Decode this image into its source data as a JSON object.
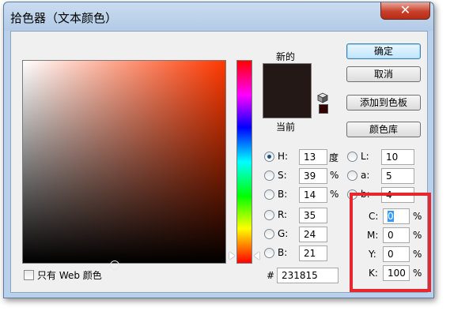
{
  "window": {
    "title": "拾色器（文本颜色）",
    "close_label": "✕"
  },
  "swatch": {
    "new_label": "新的",
    "current_label": "当前",
    "new_color": "#231815",
    "current_color": "#231815"
  },
  "buttons": {
    "ok": "确定",
    "cancel": "取消",
    "add_swatch": "添加到色板",
    "libraries": "颜色库"
  },
  "hsb": {
    "h_label": "H:",
    "h_value": "13",
    "h_unit": "度",
    "s_label": "S:",
    "s_value": "39",
    "s_unit": "%",
    "b_label": "B:",
    "b_value": "14",
    "b_unit": "%",
    "selected": "H"
  },
  "lab": {
    "l_label": "L:",
    "l_value": "10",
    "a_label": "a:",
    "a_value": "5",
    "b_label": "b:",
    "b_value": "4"
  },
  "rgb": {
    "r_label": "R:",
    "r_value": "35",
    "g_label": "G:",
    "g_value": "24",
    "b_label": "B:",
    "b_value": "21"
  },
  "cmyk": {
    "c_label": "C:",
    "c_value": "0",
    "c_unit": "%",
    "m_label": "M:",
    "m_value": "0",
    "m_unit": "%",
    "y_label": "Y:",
    "y_value": "0",
    "y_unit": "%",
    "k_label": "K:",
    "k_value": "100",
    "k_unit": "%"
  },
  "hex": {
    "label": "#",
    "value": "231815"
  },
  "web_only": {
    "label": "只有 Web 颜色",
    "checked": false
  },
  "colors": {
    "highlight_box": "#e8262e",
    "field_hue": "#ff3800"
  }
}
